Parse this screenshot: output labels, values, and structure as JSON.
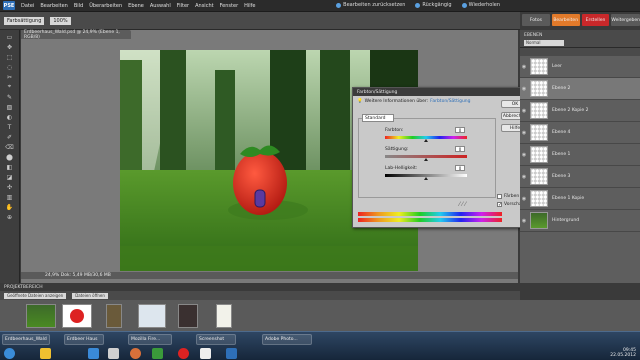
{
  "app": {
    "logo": "PSE"
  },
  "menu": [
    "Datei",
    "Bearbeiten",
    "Bild",
    "Überarbeiten",
    "Ebene",
    "Auswahl",
    "Filter",
    "Ansicht",
    "Fenster",
    "Hilfe"
  ],
  "menu_right": [
    "Bearbeiten zurücksetzen",
    "Rückgängig",
    "Wiederholen"
  ],
  "options": {
    "field1": "Farbsättigung",
    "field2": "100%"
  },
  "mode_tabs": [
    {
      "label": "Fotos",
      "state": "normal"
    },
    {
      "label": "Bearbeiten",
      "state": "active"
    },
    {
      "label": "Erstellen",
      "state": "red"
    },
    {
      "label": "Weitergeben",
      "state": "normal"
    }
  ],
  "tools": [
    "▭",
    "✥",
    "⬚",
    "◌",
    "✂",
    "⌖",
    "✎",
    "▧",
    "◐",
    "T",
    "✐",
    "⌫",
    "⬤",
    "◧",
    "◪",
    "✣",
    "▥",
    "✋",
    "⊕"
  ],
  "document": {
    "tab_title": "Erdbeerhaus_Wald.psd @ 24,9% (Ebene 1, RGB/8)",
    "status": "24,9%   Dok: 5,49 MB/30,6 MB"
  },
  "dialog": {
    "title": "Farbton/Sättigung",
    "info": "Weitere Informationen über:",
    "info_link": "Farbton/Sättigung",
    "buttons": [
      "OK",
      "Abbrechen",
      "Hilfe"
    ],
    "edit_value": "Standard",
    "sliders": [
      {
        "label": "Farbton:",
        "value": "0",
        "position": 0.5
      },
      {
        "label": "Sättigung:",
        "value": "0",
        "position": 0.5
      },
      {
        "label": "Lab-Helligkeit:",
        "value": "0",
        "position": 0.5
      }
    ],
    "checkboxes": [
      {
        "label": "Färben",
        "checked": false
      },
      {
        "label": "Vorschau",
        "checked": true
      }
    ]
  },
  "layers_panel": {
    "header": "EBENEN",
    "blend": "Normal",
    "layers": [
      {
        "name": "Leer",
        "thumb": "checker",
        "selected": false
      },
      {
        "name": "Ebene 2",
        "thumb": "checker",
        "selected": true
      },
      {
        "name": "Ebene 2 Kopie 2",
        "thumb": "checker",
        "selected": false
      },
      {
        "name": "Ebene 4",
        "thumb": "checker",
        "selected": false
      },
      {
        "name": "Ebene 1",
        "thumb": "checker",
        "selected": false
      },
      {
        "name": "Ebene 3",
        "thumb": "checker",
        "selected": false
      },
      {
        "name": "Ebene 1 Kopie",
        "thumb": "checker",
        "selected": false
      },
      {
        "name": "Hintergrund",
        "thumb": "forest",
        "selected": false
      }
    ]
  },
  "project_bin": {
    "label": "PROJEKTBEREICH",
    "fields": [
      "Geöffnete Dateien anzeigen",
      "Dateien öffnen"
    ]
  },
  "taskbar": {
    "tasks": [
      "Erdbeerhaus_Wald",
      "Erdbeer Haus",
      "Mozilla Fire...",
      "Screenshot",
      "Adobe Photo..."
    ],
    "time": "09:45",
    "date": "22.05.2012"
  },
  "colors": {
    "accent_tab": "#e27a2a",
    "red_tab": "#c8282a",
    "logo": "#2e6fb7"
  }
}
